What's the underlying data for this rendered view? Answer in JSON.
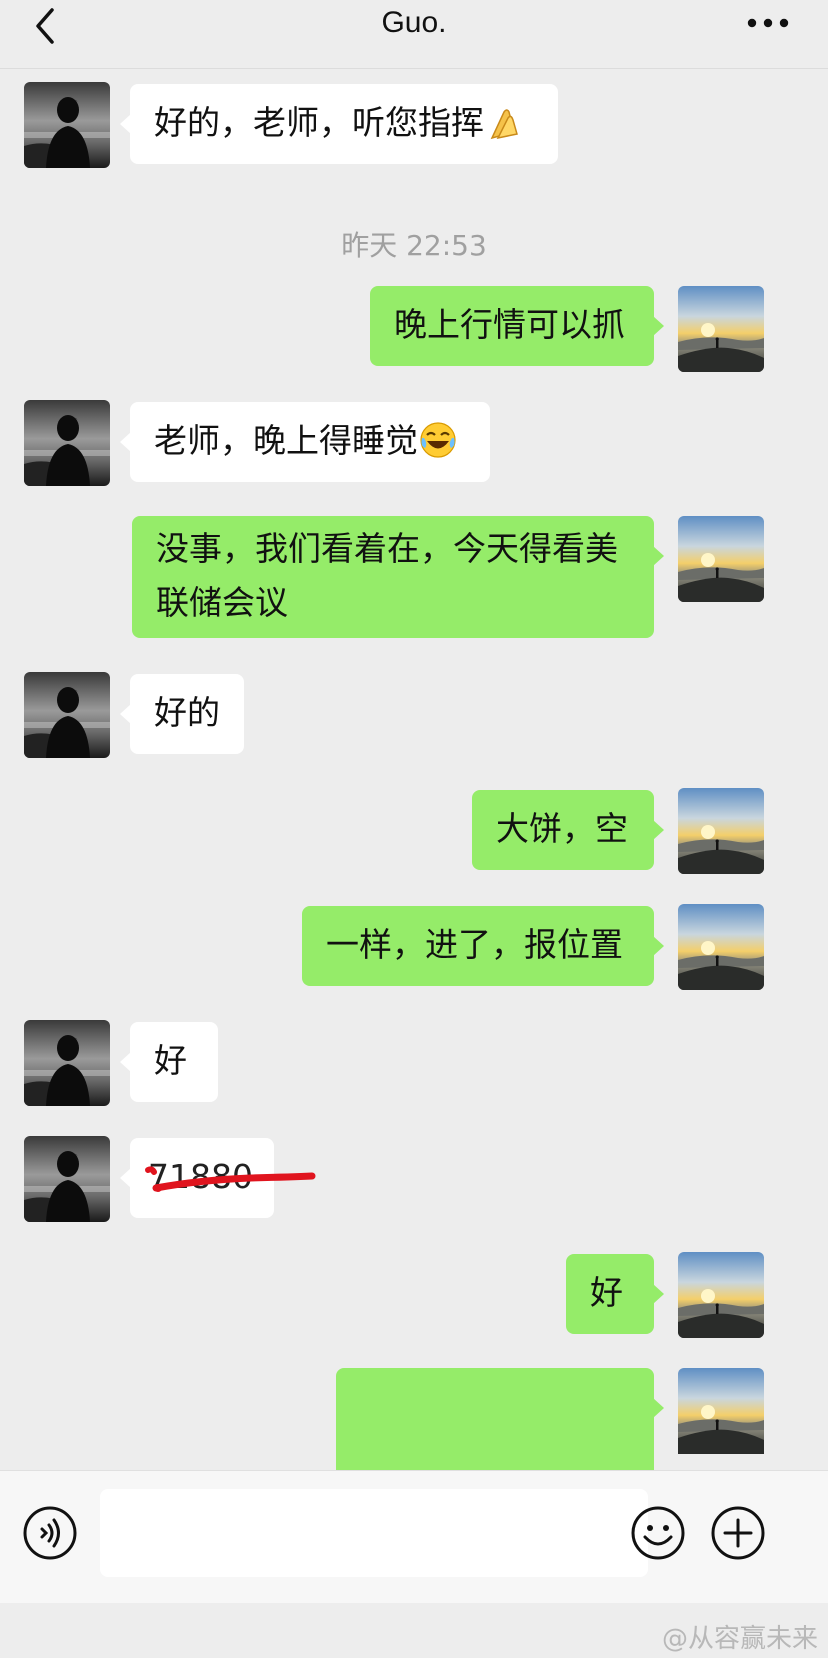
{
  "header": {
    "title": "Guo."
  },
  "timestamp": "昨天 22:53",
  "messages": [
    {
      "side": "left",
      "text": "好的，老师，听您指挥"
    },
    {
      "side": "right",
      "text": "晚上行情可以抓"
    },
    {
      "side": "left",
      "text": "老师，晚上得睡觉"
    },
    {
      "side": "right",
      "line1": "没事，我们看着在，今天得看美",
      "line2": "联储会议"
    },
    {
      "side": "left",
      "text": "好的"
    },
    {
      "side": "right",
      "text": "大饼，空"
    },
    {
      "side": "right",
      "text": "一样，进了，报位置"
    },
    {
      "side": "left",
      "text": "好"
    },
    {
      "side": "left",
      "text": "71880"
    },
    {
      "side": "right",
      "text": "好"
    }
  ],
  "watermark": "@从容赢未来",
  "colors": {
    "background": "#ededed",
    "sent_bubble": "#95ec69",
    "received_bubble": "#ffffff",
    "redaction": "#e0141e"
  },
  "icons": {
    "back": "chevron-left-icon",
    "more": "more-dots-icon",
    "voice": "voice-icon",
    "emoji": "emoji-icon",
    "plus": "plus-icon"
  }
}
